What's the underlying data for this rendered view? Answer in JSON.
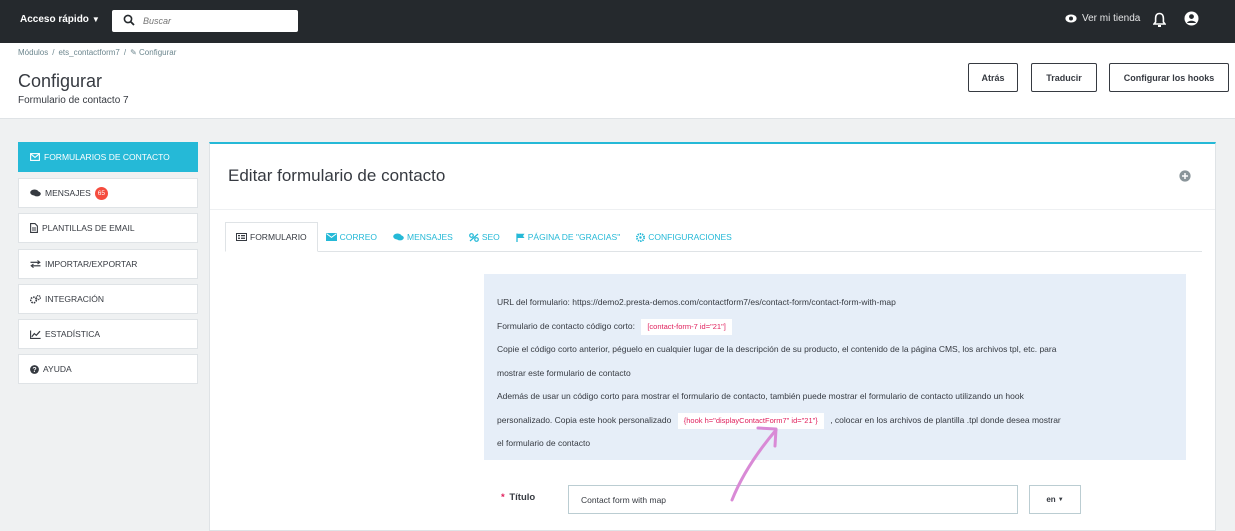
{
  "topbar": {
    "quick_access": "Acceso rápido",
    "search_placeholder": "Buscar",
    "view_store": "Ver mi tienda"
  },
  "header": {
    "breadcrumb": [
      "Módulos",
      "/",
      "ets_contactform7",
      "/",
      "Configurar"
    ],
    "title": "Configurar",
    "subtitle": "Formulario de contacto 7",
    "buttons": {
      "back": "Atrás",
      "translate": "Traducir",
      "hooks": "Configurar los hooks"
    }
  },
  "sidebar": {
    "items": [
      {
        "label": "FORMULARIOS DE CONTACTO",
        "icon": "envelope-icon"
      },
      {
        "label": "MENSAJES",
        "icon": "comments-icon",
        "badge": "65"
      },
      {
        "label": "PLANTILLAS DE EMAIL",
        "icon": "file-icon"
      },
      {
        "label": "IMPORTAR/EXPORTAR",
        "icon": "exchange-icon"
      },
      {
        "label": "INTEGRACIÓN",
        "icon": "cogs-icon"
      },
      {
        "label": "ESTADÍSTICA",
        "icon": "line-chart-icon"
      },
      {
        "label": "AYUDA",
        "icon": "question-icon"
      }
    ]
  },
  "panel": {
    "title": "Editar formulario de contacto",
    "tabs": [
      {
        "label": "FORMULARIO",
        "icon": "list-icon"
      },
      {
        "label": "CORREO",
        "icon": "envelope-icon"
      },
      {
        "label": "MENSAJES",
        "icon": "comments-icon"
      },
      {
        "label": "SEO",
        "icon": "link-icon"
      },
      {
        "label": "PÁGINA DE \"GRACIAS\"",
        "icon": "flag-icon"
      },
      {
        "label": "CONFIGURACIONES",
        "icon": "gear-icon"
      }
    ],
    "info": {
      "url_label": "URL del formulario:",
      "url": "https://demo2.presta-demos.com/contactform7/es/contact-form/contact-form-with-map",
      "shortcode_label": "Formulario de contacto código corto:",
      "shortcode": "[contact-form-7 id=\"21\"]",
      "copy_line1": "Copie el código corto anterior, péguelo en cualquier lugar de la descripción de su producto, el contenido de la página CMS, los archivos tpl, etc. para",
      "copy_line2": "mostrar este formulario de contacto",
      "hook_line1": "Además de usar un código corto para mostrar el formulario de contacto, también puede mostrar el formulario de contacto utilizando un hook",
      "hook_line2_pre": "personalizado. Copia este hook personalizado",
      "hook_code": "{hook h=\"displayContactForm7\" id=\"21\"}",
      "hook_line2_post": ", colocar en los archivos de plantilla .tpl donde desea mostrar",
      "hook_line3": "el formulario de contacto"
    },
    "title_field": {
      "required_mark": "*",
      "label": "Título",
      "value": "Contact form with map",
      "lang": "en"
    }
  },
  "colors": {
    "accent": "#25b9d7",
    "topbar": "#25292d",
    "annotation_arrow": "#d98ad6",
    "code_text": "#e0205c",
    "badge": "#f54c3e"
  }
}
